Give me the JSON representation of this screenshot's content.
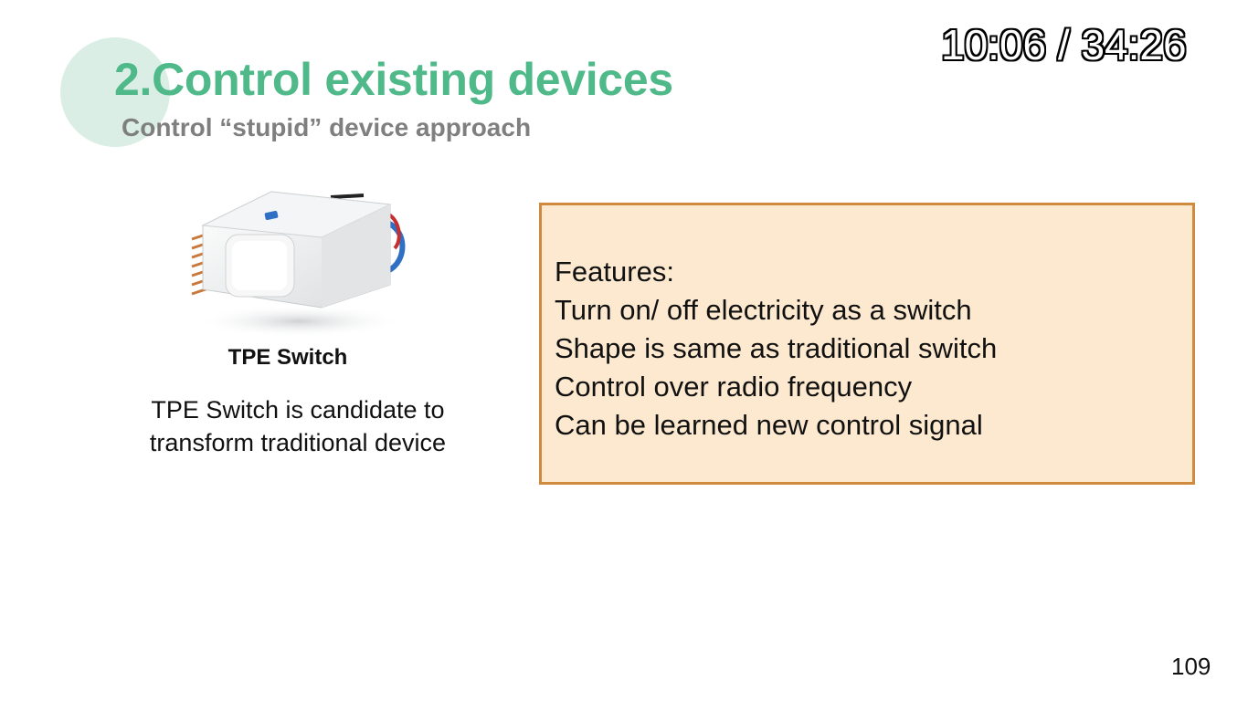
{
  "slide": {
    "title": "2.Control existing devices",
    "subtitle": "Control “stupid” device approach",
    "page_number": "109"
  },
  "player": {
    "timestamp": "10:06 / 34:26"
  },
  "product": {
    "image_icon": "tpe-switch-device-photo",
    "caption": "TPE Switch",
    "description_lines": [
      "TPE  Switch is candidate to",
      "transform traditional device"
    ]
  },
  "features": {
    "items": [
      "Features:",
      "Turn on/ off electricity as a switch",
      "Shape is same as traditional switch",
      "Control over radio frequency",
      "Can be learned new control signal"
    ]
  },
  "colors": {
    "title_green": "#4fb989",
    "subtitle_gray": "#7f7f7f",
    "box_fill": "#fde9cf",
    "box_border": "#d08a3d",
    "circle_accent": "#dbeee5"
  }
}
